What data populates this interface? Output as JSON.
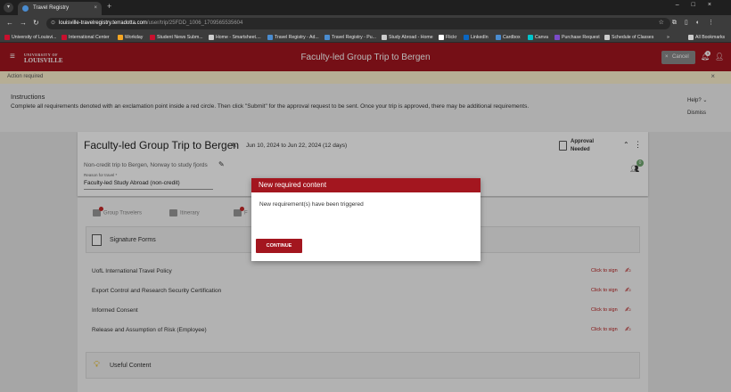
{
  "browser": {
    "tab_title": "Travel Registry",
    "url_host": "louisville-travelregistry.terradotta.com",
    "url_path": "/user/trip/25FDD_1006_1709565535604",
    "bookmarks": [
      {
        "label": "University of Louisvi...",
        "color": "#c8102e"
      },
      {
        "label": "International Center",
        "color": "#c8102e"
      },
      {
        "label": "Workday",
        "color": "#f5a623"
      },
      {
        "label": "Student News Subm...",
        "color": "#c8102e"
      },
      {
        "label": "Home - Smartsheet....",
        "color": "#cccccc"
      },
      {
        "label": "Travel Registry - Ad...",
        "color": "#4a8cd0"
      },
      {
        "label": "Travel Registry - Pu...",
        "color": "#4a8cd0"
      },
      {
        "label": "Study Abroad - Home",
        "color": "#cccccc"
      },
      {
        "label": "Flickr",
        "color": "#ffffff"
      },
      {
        "label": "LinkedIn",
        "color": "#0a66c2"
      },
      {
        "label": "Cardbox",
        "color": "#4a8cd0"
      },
      {
        "label": "Canva",
        "color": "#00c4cc"
      },
      {
        "label": "Purchase Request",
        "color": "#7b4bc9"
      },
      {
        "label": "Schedule of Classes",
        "color": "#cccccc"
      }
    ],
    "more_bookmarks": "»",
    "all_bookmarks": "All Bookmarks"
  },
  "header": {
    "logo_small": "UNIVERSITY OF",
    "logo_main": "LOUISVILLE",
    "title": "Faculty-led Group Trip to Bergen",
    "cancel_label": "Cancel",
    "notification_count": "1"
  },
  "banner": {
    "text": "Action required",
    "close": "×"
  },
  "instructions": {
    "title": "Instructions",
    "text": "Complete all requirements denoted with an exclamation point inside a red circle. Then click \"Submit\" for the approval request to be sent. Once your trip is approved, there may be additional requirements.",
    "help_label": "Help?",
    "dismiss_label": "Dismiss"
  },
  "trip": {
    "title": "Faculty-led Group Trip to Bergen",
    "dates": "Jun 10, 2024 to Jun 22, 2024  (12 days)",
    "status_line1": "Approval",
    "status_line2": "Needed",
    "subtitle": "Non-credit trip to Bergen, Norway to study fjords",
    "reason_label": "Reason for travel *",
    "reason_value": "Faculty-led Study Abroad (non-credit)",
    "travelers_count": "0"
  },
  "tabs": [
    {
      "label": "Group Travelers"
    },
    {
      "label": "Itinerary"
    },
    {
      "label": "F"
    }
  ],
  "signature_section": {
    "label": "Signature Forms"
  },
  "forms": [
    {
      "label": "UofL International Travel Policy",
      "action": "Click to sign"
    },
    {
      "label": "Export Control and Research Security Certification",
      "action": "Click to sign"
    },
    {
      "label": "Informed Consent",
      "action": "Click to sign"
    },
    {
      "label": "Release and Assumption of Risk (Employee)",
      "action": "Click to sign"
    }
  ],
  "useful_section": {
    "label": "Useful Content"
  },
  "modal": {
    "title": "New required content",
    "body": "New requirement(s) have been triggered",
    "button": "CONTINUE"
  }
}
